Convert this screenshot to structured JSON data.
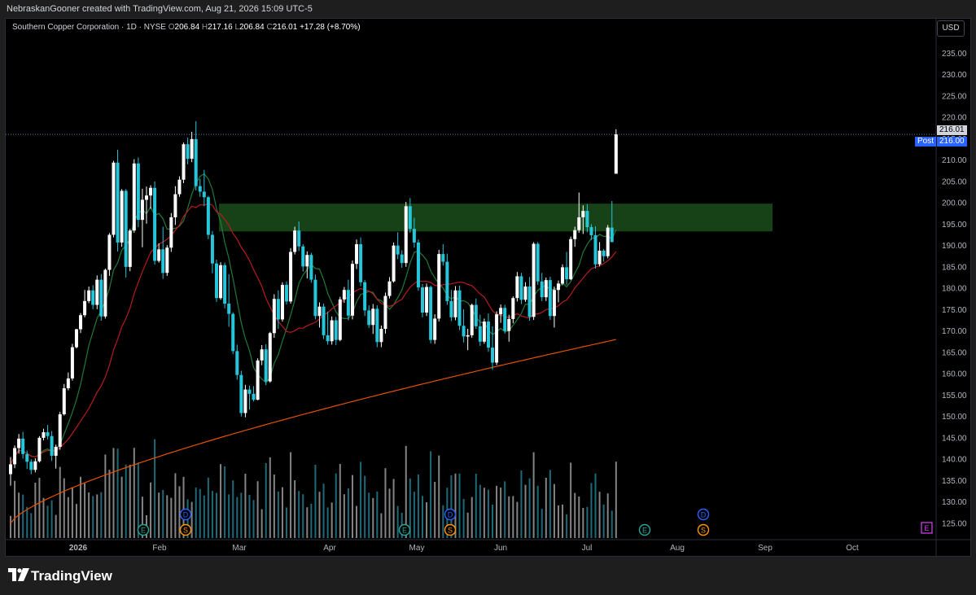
{
  "header": {
    "attribution": "NebraskanGooner created with TradingView.com, Aug 21, 2026 15:09 UTC-5"
  },
  "legend": {
    "symbol": "Southern Copper Corporation · 1D · NYSE",
    "open_label": "O",
    "open": "206.84",
    "high_label": "H",
    "high": "217.16",
    "low_label": "L",
    "low": "206.84",
    "close_label": "C",
    "close": "216.01",
    "change": "+17.28 (+8.70%)"
  },
  "currency_button": "USD",
  "price_badges": {
    "last": "216.01",
    "post_label": "Post",
    "post": "216.00"
  },
  "brand": "TradingView",
  "colors": {
    "up": "#ffffff",
    "down": "#26c6da",
    "accent_blue": "#2962ff",
    "zone_fill": "#1b4d1b",
    "ma_short": "#1f7a3a",
    "ma_mid": "#b71c1c",
    "ma_long": "#e65100",
    "events_purple": "#e040fb"
  },
  "event_markers": {
    "earnings_icon": "E",
    "dividend_icon": "D",
    "split_icon": "S"
  },
  "chart_data": {
    "type": "candlestick",
    "title": "Southern Copper Corporation · 1D · NYSE",
    "currency": "USD",
    "y_axis_ticks": [
      "235.00",
      "230.00",
      "225.00",
      "220.00",
      "215.00",
      "210.00",
      "205.00",
      "200.00",
      "195.00",
      "190.00",
      "185.00",
      "180.00",
      "175.00",
      "170.00",
      "165.00",
      "160.00",
      "155.00",
      "150.00",
      "145.00",
      "140.00",
      "135.00",
      "130.00",
      "125.00"
    ],
    "x_axis_ticks": [
      "2026",
      "Feb",
      "Mar",
      "Apr",
      "May",
      "Jun",
      "Jul",
      "Aug",
      "Sep",
      "Oct"
    ],
    "ylim": [
      122.5,
      238.5
    ],
    "last_price": 216.01,
    "resistance_zone": [
      193.3,
      199.8
    ],
    "ohlc_approx": [
      [
        136.5,
        140.5,
        133.8,
        138.8
      ],
      [
        138.8,
        143.2,
        137.9,
        142.6
      ],
      [
        142.6,
        145.9,
        141.3,
        144.8
      ],
      [
        144.8,
        146.4,
        140.1,
        141.2
      ],
      [
        141.2,
        142.0,
        137.7,
        139.4
      ],
      [
        139.4,
        140.0,
        136.5,
        137.5
      ],
      [
        137.5,
        140.2,
        136.9,
        139.5
      ],
      [
        139.5,
        145.4,
        139.2,
        145.0
      ],
      [
        145.0,
        147.1,
        144.4,
        146.3
      ],
      [
        146.3,
        148.0,
        144.6,
        145.4
      ],
      [
        145.4,
        146.6,
        139.6,
        140.8
      ],
      [
        140.8,
        143.4,
        137.8,
        142.9
      ],
      [
        142.9,
        151.1,
        142.2,
        150.5
      ],
      [
        150.5,
        157.6,
        150.2,
        156.6
      ],
      [
        156.6,
        160.3,
        156.1,
        158.9
      ],
      [
        158.9,
        167.0,
        158.4,
        166.2
      ],
      [
        166.2,
        170.5,
        165.9,
        170.4
      ],
      [
        170.4,
        174.2,
        169.5,
        173.7
      ],
      [
        173.7,
        179.6,
        173.2,
        177.0
      ],
      [
        177.0,
        180.4,
        176.5,
        179.5
      ],
      [
        179.5,
        180.7,
        175.1,
        176.1
      ],
      [
        176.1,
        183.0,
        175.1,
        182.0
      ],
      [
        182.0,
        183.3,
        172.4,
        173.4
      ],
      [
        173.4,
        184.6,
        172.9,
        184.3
      ],
      [
        184.3,
        192.9,
        182.9,
        192.5
      ],
      [
        192.5,
        209.8,
        191.9,
        209.4
      ],
      [
        209.4,
        212.4,
        188.6,
        190.7
      ],
      [
        190.7,
        203.2,
        189.7,
        202.8
      ],
      [
        202.8,
        203.2,
        182.5,
        185.0
      ],
      [
        185.0,
        193.9,
        184.0,
        193.5
      ],
      [
        193.5,
        210.2,
        193.0,
        209.2
      ],
      [
        209.2,
        210.6,
        194.3,
        196.0
      ],
      [
        196.0,
        203.3,
        189.6,
        200.7
      ],
      [
        200.7,
        203.8,
        195.1,
        201.7
      ],
      [
        201.7,
        204.1,
        198.6,
        203.5
      ],
      [
        203.5,
        205.0,
        185.5,
        186.4
      ],
      [
        186.4,
        190.5,
        186.0,
        189.1
      ],
      [
        189.1,
        194.4,
        182.2,
        183.6
      ],
      [
        183.6,
        190.1,
        182.9,
        189.5
      ],
      [
        189.5,
        197.6,
        188.5,
        196.6
      ],
      [
        196.6,
        203.9,
        194.8,
        202.0
      ],
      [
        202.0,
        206.2,
        201.4,
        205.4
      ],
      [
        205.4,
        214.1,
        204.6,
        213.7
      ],
      [
        213.7,
        215.2,
        209.0,
        210.3
      ],
      [
        210.3,
        216.6,
        209.5,
        214.9
      ],
      [
        214.9,
        219.1,
        202.9,
        203.9
      ],
      [
        203.9,
        205.6,
        201.4,
        202.6
      ],
      [
        202.6,
        207.7,
        199.2,
        201.3
      ],
      [
        201.3,
        201.6,
        191.5,
        192.5
      ],
      [
        192.5,
        193.4,
        183.5,
        185.8
      ],
      [
        185.8,
        186.7,
        176.8,
        177.7
      ],
      [
        177.7,
        186.1,
        177.3,
        185.4
      ],
      [
        185.4,
        186.0,
        175.3,
        176.4
      ],
      [
        176.4,
        183.3,
        171.0,
        174.0
      ],
      [
        174.0,
        174.4,
        164.6,
        165.3
      ],
      [
        165.3,
        166.8,
        158.6,
        159.7
      ],
      [
        159.7,
        160.7,
        150.0,
        150.8
      ],
      [
        150.8,
        157.4,
        149.8,
        156.3
      ],
      [
        156.3,
        157.2,
        151.6,
        155.3
      ],
      [
        155.3,
        157.1,
        153.5,
        153.9
      ],
      [
        153.9,
        163.6,
        153.8,
        163.1
      ],
      [
        163.1,
        166.7,
        162.0,
        165.7
      ],
      [
        165.7,
        166.9,
        157.3,
        158.2
      ],
      [
        158.2,
        169.8,
        157.9,
        169.5
      ],
      [
        169.5,
        178.6,
        168.4,
        177.5
      ],
      [
        177.5,
        179.5,
        170.5,
        172.7
      ],
      [
        172.7,
        181.4,
        172.2,
        180.8
      ],
      [
        180.8,
        181.6,
        176.2,
        176.9
      ],
      [
        176.9,
        189.4,
        176.4,
        188.5
      ],
      [
        188.5,
        194.4,
        187.9,
        193.5
      ],
      [
        193.5,
        195.6,
        188.7,
        189.8
      ],
      [
        189.8,
        190.3,
        183.9,
        185.1
      ],
      [
        185.1,
        188.6,
        182.3,
        187.8
      ],
      [
        187.8,
        188.3,
        181.3,
        182.0
      ],
      [
        182.0,
        183.2,
        172.7,
        173.5
      ],
      [
        173.5,
        176.7,
        170.8,
        175.7
      ],
      [
        175.7,
        176.4,
        168.1,
        169.0
      ],
      [
        169.0,
        174.5,
        166.8,
        167.6
      ],
      [
        167.6,
        173.4,
        166.8,
        172.5
      ],
      [
        172.5,
        173.3,
        166.7,
        167.9
      ],
      [
        167.9,
        178.0,
        167.6,
        177.4
      ],
      [
        177.4,
        180.3,
        176.6,
        179.6
      ],
      [
        179.6,
        182.0,
        172.5,
        173.6
      ],
      [
        173.6,
        186.5,
        172.7,
        185.7
      ],
      [
        185.7,
        191.4,
        184.5,
        190.3
      ],
      [
        190.3,
        191.9,
        180.5,
        181.4
      ],
      [
        181.4,
        181.9,
        173.5,
        174.8
      ],
      [
        174.8,
        176.0,
        170.7,
        171.4
      ],
      [
        171.4,
        176.3,
        169.3,
        175.2
      ],
      [
        175.2,
        176.0,
        166.2,
        167.4
      ],
      [
        167.4,
        171.3,
        166.2,
        170.5
      ],
      [
        170.5,
        179.0,
        169.4,
        178.2
      ],
      [
        178.2,
        182.6,
        177.6,
        181.6
      ],
      [
        181.6,
        190.7,
        181.3,
        190.0
      ],
      [
        190.0,
        193.1,
        186.8,
        187.9
      ],
      [
        187.9,
        188.9,
        184.8,
        185.9
      ],
      [
        185.9,
        200.2,
        185.0,
        199.2
      ],
      [
        199.2,
        201.1,
        193.0,
        193.9
      ],
      [
        193.9,
        196.5,
        189.5,
        190.7
      ],
      [
        190.7,
        191.4,
        179.4,
        180.2
      ],
      [
        180.2,
        181.0,
        173.2,
        174.3
      ],
      [
        174.3,
        181.1,
        173.5,
        180.3
      ],
      [
        180.3,
        180.6,
        167.1,
        167.9
      ],
      [
        167.9,
        173.9,
        167.0,
        172.9
      ],
      [
        172.9,
        189.0,
        172.2,
        188.0
      ],
      [
        188.0,
        190.3,
        185.3,
        186.2
      ],
      [
        186.2,
        188.1,
        176.1,
        177.0
      ],
      [
        177.0,
        179.6,
        172.3,
        173.2
      ],
      [
        173.2,
        180.5,
        172.5,
        179.5
      ],
      [
        179.5,
        180.6,
        170.2,
        171.2
      ],
      [
        171.2,
        175.1,
        167.3,
        168.7
      ],
      [
        168.7,
        170.5,
        165.5,
        169.0
      ],
      [
        169.0,
        176.4,
        168.4,
        176.1
      ],
      [
        176.1,
        177.6,
        170.5,
        171.1
      ],
      [
        171.1,
        173.8,
        166.5,
        167.5
      ],
      [
        167.5,
        172.9,
        167.0,
        172.2
      ],
      [
        172.2,
        174.1,
        165.1,
        166.1
      ],
      [
        166.1,
        171.1,
        160.9,
        162.6
      ],
      [
        162.6,
        174.6,
        162.0,
        173.9
      ],
      [
        173.9,
        176.2,
        171.9,
        175.4
      ],
      [
        175.4,
        176.1,
        169.4,
        170.0
      ],
      [
        170.0,
        173.8,
        167.5,
        172.8
      ],
      [
        172.8,
        178.1,
        171.8,
        177.7
      ],
      [
        177.7,
        183.8,
        176.9,
        182.8
      ],
      [
        182.8,
        183.6,
        176.3,
        177.3
      ],
      [
        177.3,
        181.4,
        176.8,
        180.4
      ],
      [
        180.4,
        182.6,
        172.4,
        173.3
      ],
      [
        173.3,
        190.8,
        172.6,
        190.4
      ],
      [
        190.4,
        190.8,
        180.8,
        181.6
      ],
      [
        181.6,
        183.6,
        177.0,
        177.9
      ],
      [
        177.9,
        182.5,
        177.0,
        181.9
      ],
      [
        181.9,
        182.7,
        172.6,
        173.5
      ],
      [
        173.5,
        180.4,
        170.8,
        179.6
      ],
      [
        179.6,
        181.8,
        176.7,
        181.1
      ],
      [
        181.1,
        185.6,
        180.7,
        184.9
      ],
      [
        184.9,
        188.5,
        180.8,
        182.1
      ],
      [
        182.1,
        192.1,
        181.9,
        191.5
      ],
      [
        191.5,
        194.4,
        189.7,
        193.6
      ],
      [
        193.6,
        202.4,
        193.0,
        196.6
      ],
      [
        196.6,
        199.4,
        192.7,
        198.1
      ],
      [
        198.1,
        199.7,
        193.1,
        194.3
      ],
      [
        194.3,
        195.0,
        191.3,
        192.4
      ],
      [
        192.4,
        194.5,
        184.6,
        185.6
      ],
      [
        185.6,
        190.8,
        185.1,
        188.8
      ],
      [
        188.8,
        189.2,
        186.2,
        187.5
      ],
      [
        187.5,
        194.8,
        187.0,
        194.2
      ],
      [
        194.2,
        200.4,
        190.8,
        190.8
      ],
      [
        206.8,
        217.2,
        206.8,
        216.0
      ]
    ],
    "moving_averages": [
      {
        "color": "#1f7a3a",
        "role": "short"
      },
      {
        "color": "#b71c1c",
        "role": "mid"
      },
      {
        "color": "#e65100",
        "role": "long"
      }
    ]
  }
}
